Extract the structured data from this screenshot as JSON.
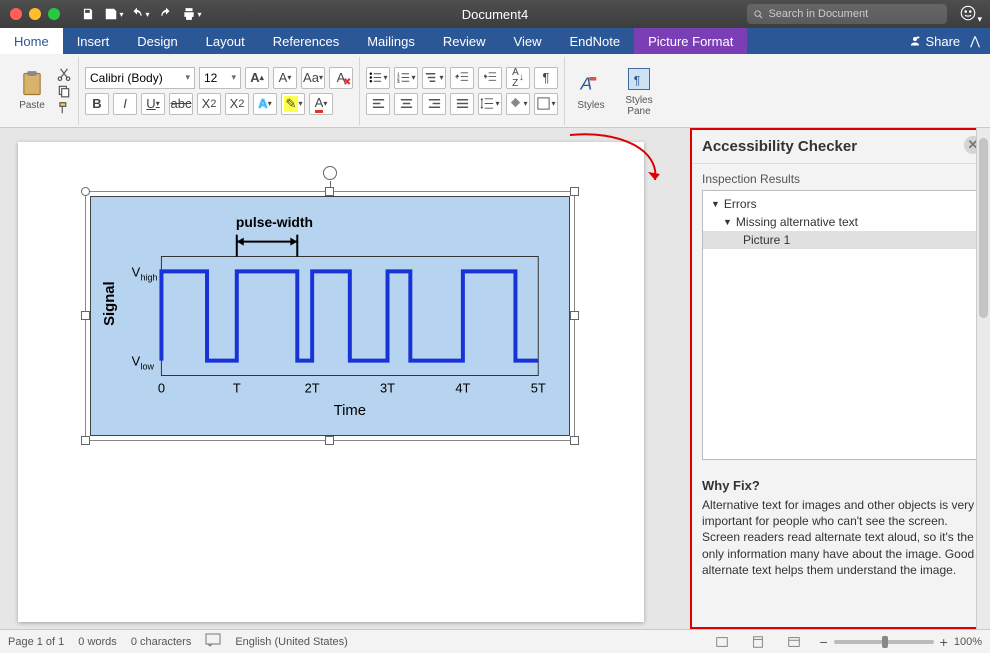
{
  "titlebar": {
    "doc": "Document4",
    "search_placeholder": "Search in Document"
  },
  "tabs": {
    "items": [
      "Home",
      "Insert",
      "Design",
      "Layout",
      "References",
      "Mailings",
      "Review",
      "View",
      "EndNote"
    ],
    "context": "Picture Format",
    "share": "Share"
  },
  "ribbon": {
    "paste": "Paste",
    "font_name": "Calibri (Body)",
    "font_size": "12",
    "styles": "Styles",
    "styles_pane": "Styles\nPane"
  },
  "pane": {
    "title": "Accessibility Checker",
    "section": "Inspection Results",
    "errors_label": "Errors",
    "err1": "Missing alternative text",
    "err1_item": "Picture 1",
    "why_title": "Why Fix?",
    "why_body": "Alternative text for images and other objects is very important for people who can't see the screen. Screen readers read alternate text aloud, so it's the only information many have about the image. Good alternate text helps them understand the image."
  },
  "status": {
    "page": "Page 1 of 1",
    "words": "0 words",
    "chars": "0 characters",
    "lang": "English (United States)",
    "zoom": "100%"
  },
  "chart_data": {
    "type": "line",
    "title": "",
    "annotation": "pulse-width",
    "xlabel": "Time",
    "ylabel": "Signal",
    "x_ticks": [
      "0",
      "T",
      "2T",
      "3T",
      "4T",
      "5T"
    ],
    "y_ticks": [
      "V_low",
      "V_high"
    ],
    "y_levels": {
      "low": 0,
      "high": 1
    },
    "series": [
      {
        "name": "signal",
        "segments_x_fraction_of_5T": [
          [
            0.0,
            0.12,
            "high"
          ],
          [
            0.12,
            0.2,
            "low"
          ],
          [
            0.2,
            0.36,
            "high"
          ],
          [
            0.36,
            0.4,
            "low"
          ],
          [
            0.4,
            0.5,
            "high"
          ],
          [
            0.5,
            0.6,
            "low"
          ],
          [
            0.6,
            0.66,
            "high"
          ],
          [
            0.66,
            0.8,
            "low"
          ],
          [
            0.8,
            0.94,
            "high"
          ],
          [
            0.94,
            1.0,
            "low"
          ]
        ]
      }
    ],
    "pulse_width_marker_between_x": [
      "T",
      "2T"
    ]
  }
}
